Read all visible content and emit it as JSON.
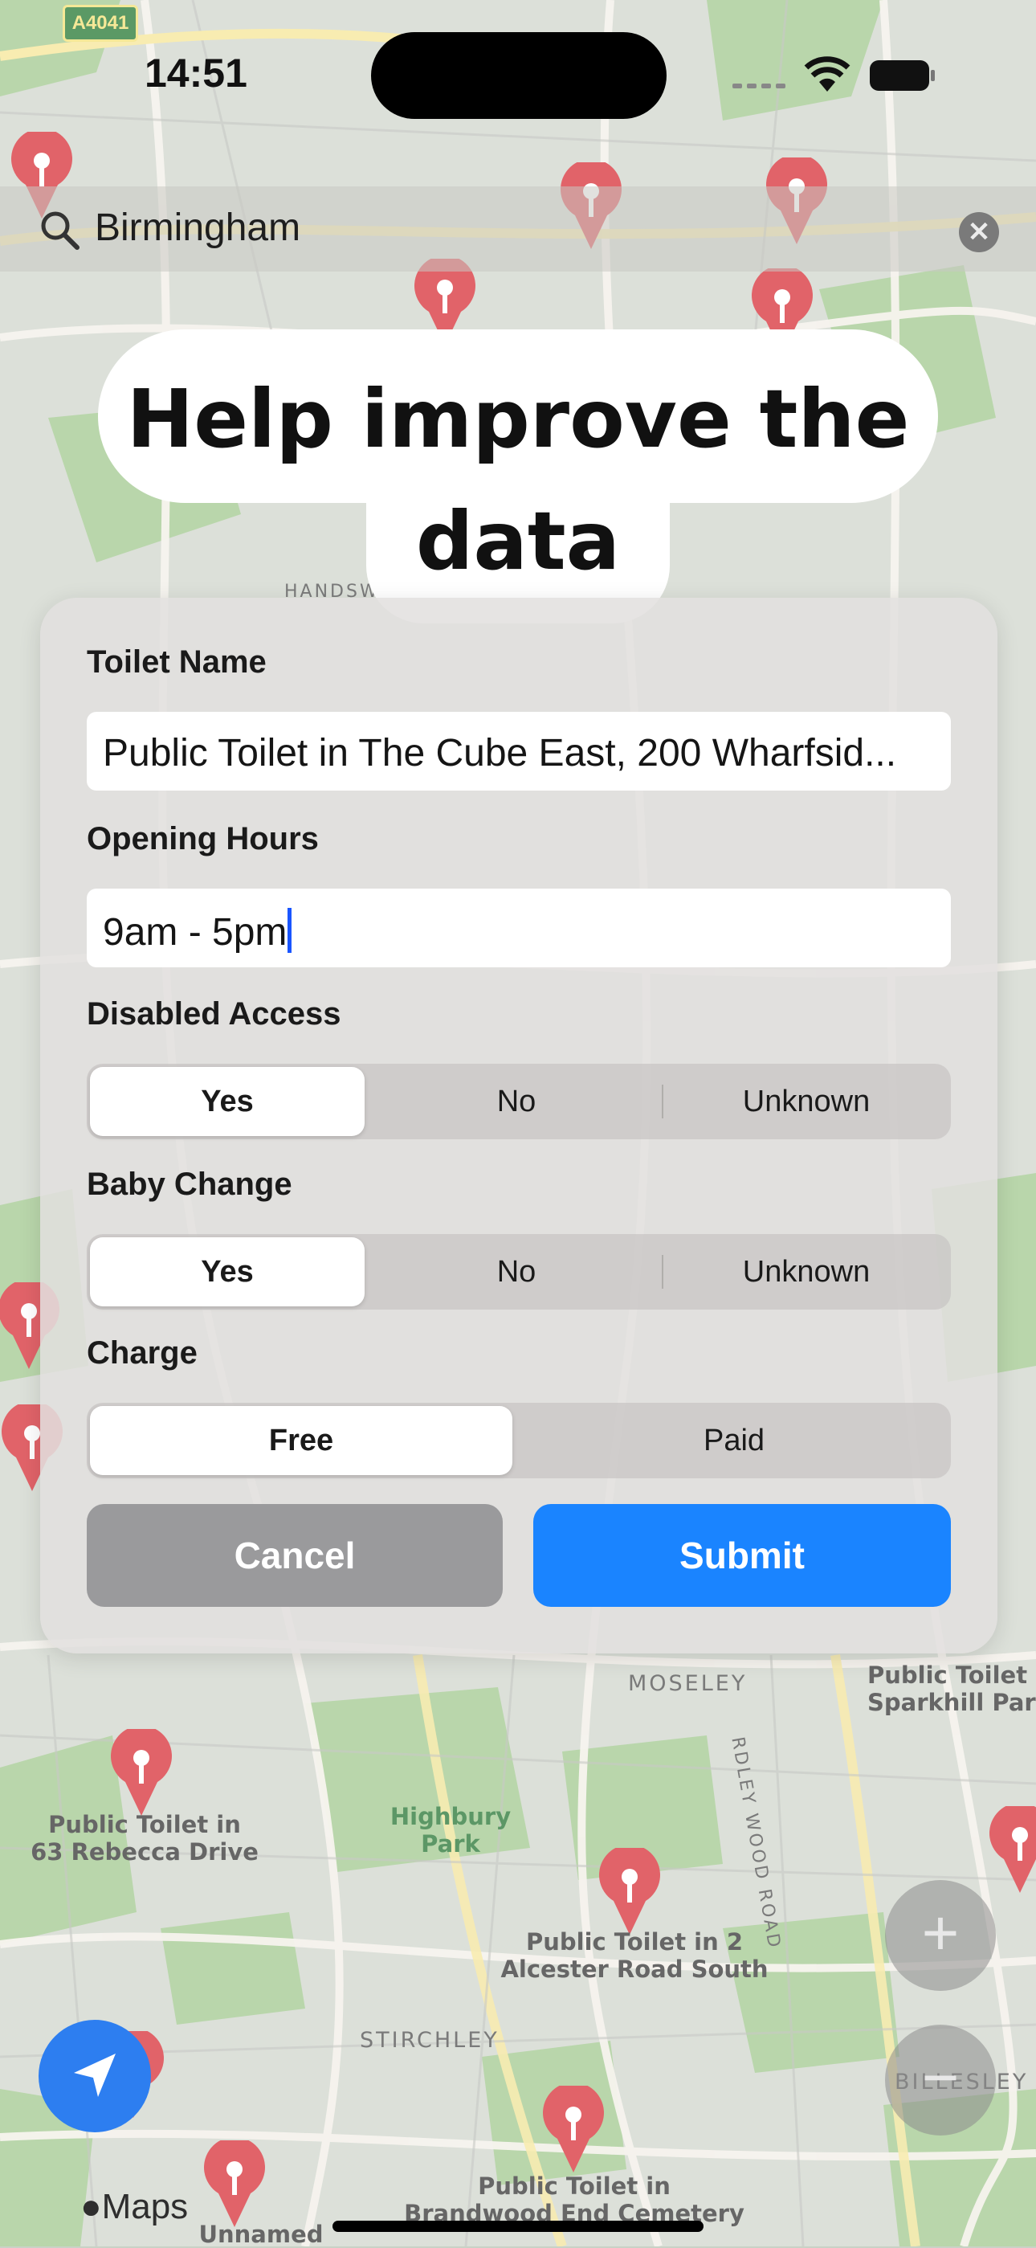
{
  "status_bar": {
    "time": "14:51"
  },
  "map": {
    "road_badge": "A4041",
    "labels": [
      "Public Toilet in\n63 Rebecca Drive",
      "Public Toilet in 2\nAlcester Road South",
      "Public Toilet in\nBrandwood End Cemetery",
      "Public Toilet i\nSparkhill Par",
      "Highbury Park",
      "MOSELEY",
      "STIRCHLEY",
      "BILLESLEY",
      "RDLEY WOOD ROAD",
      "HANDSW",
      "Unnamed"
    ]
  },
  "search": {
    "value": "Birmingham"
  },
  "heading": {
    "line1": "Help improve the",
    "line2": "data"
  },
  "form": {
    "toilet_name_label": "Toilet Name",
    "toilet_name_value": "Public Toilet in The Cube East, 200 Wharfsid...",
    "opening_hours_label": "Opening Hours",
    "opening_hours_value": "9am - 5pm",
    "disabled_access_label": "Disabled Access",
    "disabled_access_options": [
      "Yes",
      "No",
      "Unknown"
    ],
    "disabled_access_selected": "Yes",
    "baby_change_label": "Baby Change",
    "baby_change_options": [
      "Yes",
      "No",
      "Unknown"
    ],
    "baby_change_selected": "Yes",
    "charge_label": "Charge",
    "charge_options": [
      "Free",
      "Paid"
    ],
    "charge_selected": "Free",
    "cancel_label": "Cancel",
    "submit_label": "Submit"
  },
  "controls": {
    "zoom_in": "+",
    "zoom_out": "−",
    "maps_logo": "Maps"
  },
  "colors": {
    "accent": "#1a84ff",
    "pin": "#d9383f",
    "cancel": "#9a9a9c"
  }
}
